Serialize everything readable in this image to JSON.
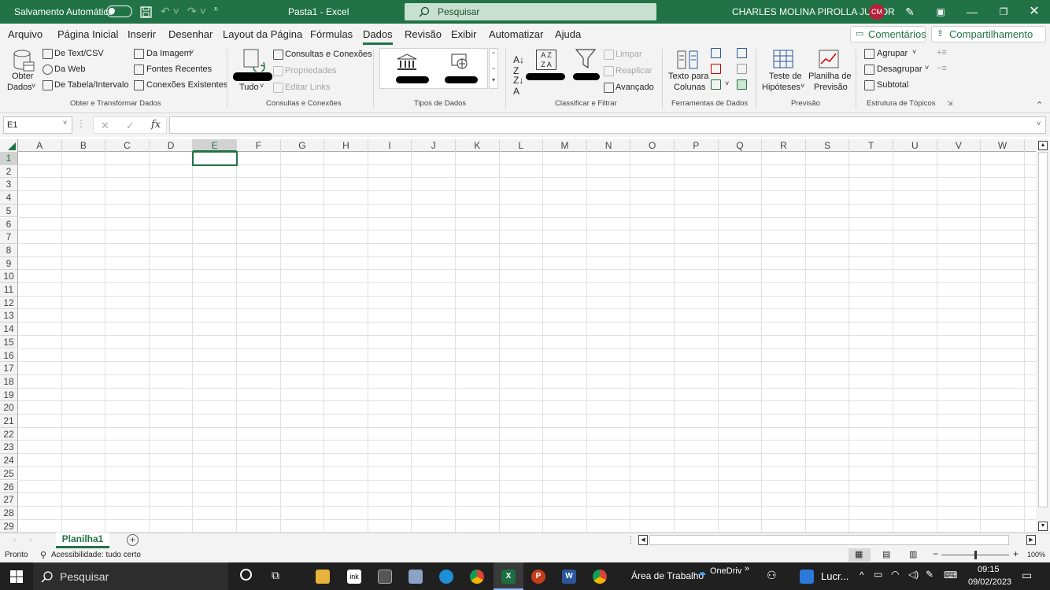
{
  "titlebar": {
    "autosave_label": "Salvamento Automático",
    "doc_title": "Pasta1  -  Excel",
    "search_placeholder": "Pesquisar",
    "user_name": "CHARLES MOLINA PIROLLA JUNIOR",
    "user_initials": "CM"
  },
  "tabs": [
    "Arquivo",
    "Página Inicial",
    "Inserir",
    "Desenhar",
    "Layout da Página",
    "Fórmulas",
    "Dados",
    "Revisão",
    "Exibir",
    "Automatizar",
    "Ajuda"
  ],
  "active_tab": "Dados",
  "comments_label": "Comentários",
  "share_label": "Compartilhamento",
  "ribbon": {
    "get_data_line1": "Obter",
    "get_data_line2": "Dados",
    "from_text_csv": "De Text/CSV",
    "from_web": "Da Web",
    "from_table": "De Tabela/Intervalo",
    "from_picture": "Da Imagem",
    "recent_sources": "Fontes Recentes",
    "existing_connections": "Conexões Existentes",
    "group_get_transform": "Obter e Transformar Dados",
    "refresh_all": "Tudo",
    "queries_connections": "Consultas e Conexões",
    "properties": "Propriedades",
    "edit_links": "Editar Links",
    "group_queries": "Consultas e Conexões",
    "group_data_types": "Tipos de Dados",
    "clear": "Limpar",
    "reapply": "Reaplicar",
    "advanced": "Avançado",
    "group_sort_filter": "Classificar e Filtrar",
    "text_to_columns_line1": "Texto para",
    "text_to_columns_line2": "Colunas",
    "group_data_tools": "Ferramentas de Dados",
    "what_if_line1": "Teste de",
    "what_if_line2": "Hipóteses",
    "forecast_line1": "Planilha de",
    "forecast_line2": "Previsão",
    "group_forecast": "Previsão",
    "group_btn": "Agrupar",
    "ungroup_btn": "Desagrupar",
    "subtotal": "Subtotal",
    "group_outline": "Estrutura de Tópicos"
  },
  "formula_bar": {
    "name_box": "E1",
    "fx": "fx",
    "value": ""
  },
  "columns": [
    "A",
    "B",
    "C",
    "D",
    "E",
    "F",
    "G",
    "H",
    "I",
    "J",
    "K",
    "L",
    "M",
    "N",
    "O",
    "P",
    "Q",
    "R",
    "S",
    "T",
    "U",
    "V",
    "W"
  ],
  "rows": [
    "1",
    "2",
    "3",
    "4",
    "5",
    "6",
    "7",
    "8",
    "9",
    "10",
    "11",
    "12",
    "13",
    "14",
    "15",
    "16",
    "17",
    "18",
    "19",
    "20",
    "21",
    "22",
    "23",
    "24",
    "25",
    "26",
    "27",
    "28",
    "29"
  ],
  "selected_cell": "E1",
  "sheet_tab": "Planilha1",
  "status": {
    "ready": "Pronto",
    "accessibility": "Acessibilidade: tudo certo",
    "zoom": "100%"
  },
  "taskbar": {
    "search": "Pesquisar",
    "desktop": "Área de Trabalho",
    "onedrive": "OneDrive",
    "app_label": "Lucr...",
    "time": "09:15",
    "date": "09/02/2023"
  },
  "colors": {
    "excel_green": "#217346",
    "taskbar": "#202020"
  }
}
